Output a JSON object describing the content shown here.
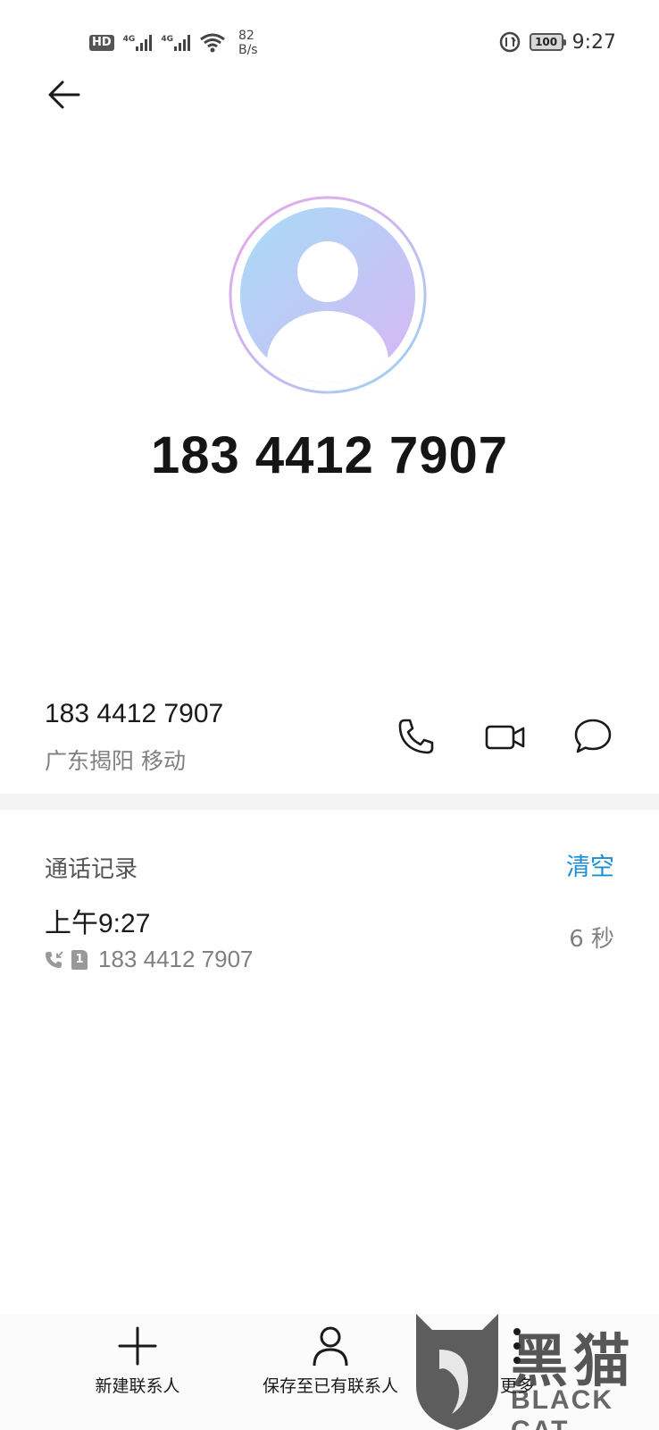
{
  "status_bar": {
    "hd_label": "HD",
    "signal1_tag": "4G",
    "signal2_tag": "4G",
    "net_speed_value": "82",
    "net_speed_unit": "B/s",
    "battery": "100",
    "time": "9:27"
  },
  "header": {
    "phone_number": "183 4412 7907"
  },
  "contact": {
    "number": "183 4412 7907",
    "location": "广东揭阳 移动",
    "actions": [
      "phone-call",
      "video-call",
      "message"
    ]
  },
  "call_log": {
    "title": "通话记录",
    "clear_label": "清空",
    "items": [
      {
        "time": "上午9:27",
        "sim": "1",
        "number": "183 4412 7907",
        "duration": "6 秒"
      }
    ]
  },
  "bottom_bar": {
    "new_contact_label": "新建联系人",
    "save_existing_label": "保存至已有联系人",
    "more_label": "更多"
  },
  "watermark": {
    "cn": "黑猫",
    "en": "BLACK CAT"
  },
  "colors": {
    "accent": "#1a8fd4",
    "secondary_text": "#808080",
    "primary_text": "#1a1a1a"
  }
}
